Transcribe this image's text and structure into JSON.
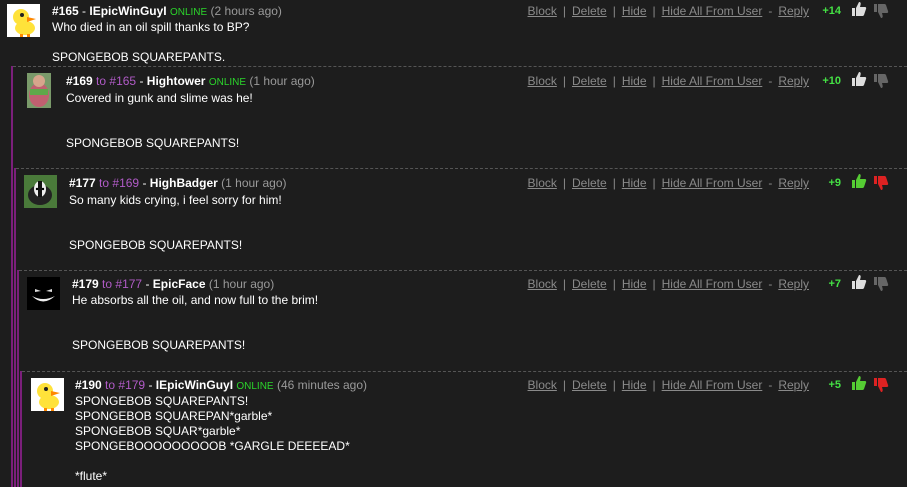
{
  "actions": {
    "block": "Block",
    "delete": "Delete",
    "hide": "Hide",
    "hide_all": "Hide All From User",
    "reply": "Reply"
  },
  "colors": {
    "online": "#2bd42b",
    "reply_to": "#b15bc7",
    "thread_line": "#7b1f7b",
    "score": "#44e044",
    "thumb_up_active": "#55cc33",
    "thumb_down_active": "#dd2222"
  },
  "comments": [
    {
      "id": "#165",
      "to_word": "",
      "to_id": "",
      "user": "IEpicWinGuyI",
      "online": "ONLINE",
      "time": "(2 hours ago)",
      "text": "Who died in an oil spill thanks to BP?\n\nSPONGEBOB SQUAREPANTS.",
      "score": "+14",
      "avatar_icon": "yellow-duck-icon"
    },
    {
      "id": "#169",
      "to_word": "to",
      "to_id": "#165",
      "user": "Hightower",
      "online": "ONLINE",
      "time": "(1 hour ago)",
      "text": "Covered in gunk and slime was he!\n\n\nSPONGEBOB SQUAREPANTS!",
      "score": "+10",
      "avatar_icon": "photo-avatar"
    },
    {
      "id": "#177",
      "to_word": "to",
      "to_id": "#169",
      "user": "HighBadger",
      "online": "",
      "time": "(1 hour ago)",
      "text": "So many kids crying, i feel sorry for him!\n\n\nSPONGEBOB SQUAREPANTS!",
      "score": "+9",
      "avatar_icon": "badger-avatar"
    },
    {
      "id": "#179",
      "to_word": "to",
      "to_id": "#177",
      "user": "EpicFace",
      "online": "",
      "time": "(1 hour ago)",
      "text": "He absorbs all the oil, and now full to the brim!\n\n\nSPONGEBOB SQUAREPANTS!",
      "score": "+7",
      "avatar_icon": "grin-face-avatar"
    },
    {
      "id": "#190",
      "to_word": "to",
      "to_id": "#179",
      "user": "IEpicWinGuyI",
      "online": "ONLINE",
      "time": "(46 minutes ago)",
      "text": "SPONGEBOB SQUAREPANTS!\nSPONGEBOB SQUAREPAN*garble*\nSPONGEBOB SQUAR*garble*\nSPONGEBOOOOOOOOOB *GARGLE DEEEEAD*\n\n*flute*",
      "score": "+5",
      "avatar_icon": "yellow-duck-icon"
    }
  ]
}
